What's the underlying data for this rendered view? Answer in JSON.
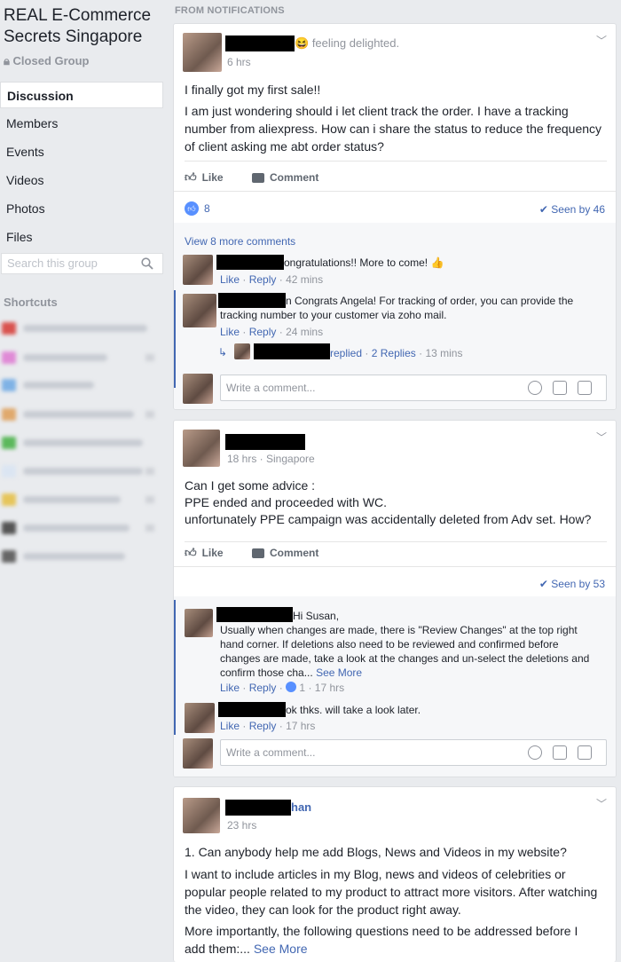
{
  "sidebar": {
    "group_name": "REAL E-Commerce Secrets Singapore",
    "privacy": "Closed Group",
    "nav": [
      "Discussion",
      "Members",
      "Events",
      "Videos",
      "Photos",
      "Files"
    ],
    "search_placeholder": "Search this group",
    "shortcuts_label": "Shortcuts"
  },
  "feed": {
    "section_label": "FROM NOTIFICATIONS",
    "like_label": "Like",
    "comment_label": "Comment",
    "write_comment_placeholder": "Write a comment...",
    "reply_label": "Reply",
    "see_more": "See More"
  },
  "post1": {
    "feeling": "feeling delighted.",
    "time": "6 hrs",
    "line1": "I finally got my first sale!!",
    "line2": "I am just wondering should i let client track the order. I have a tracking number from aliexpress. How can i share the status to reduce the frequency of client asking me abt order status?",
    "reactions": "8",
    "seen": "Seen by 46",
    "view_more": "View 8 more comments",
    "c1_text": "ongratulations!! More to come!",
    "c1_time": "42 mins",
    "c2_text": "n Congrats Angela! For tracking of order, you can provide the tracking number to your customer via zoho mail.",
    "c2_time": "24 mins",
    "reply_text": "replied",
    "reply_count": "2 Replies",
    "reply_time": "13 mins"
  },
  "post2": {
    "time": "18 hrs · Singapore",
    "line1": "Can I get some advice :",
    "line2": "PPE ended and proceeded with WC.",
    "line3": "unfortunately PPE campaign was accidentally deleted from Adv set. How?",
    "seen": "Seen by 53",
    "c1_text": "Hi Susan,\nUsually when changes are made, there is \"Review Changes\" at the top right hand corner. If deletions also need to be reviewed and confirmed before changes are made, take a look at the changes and un-select the deletions and confirm those cha...",
    "c1_likes": "1",
    "c1_time": "17 hrs",
    "c2_text": "ok thks. will take a look later.",
    "c2_time": "17 hrs"
  },
  "post3": {
    "name_suffix": "han",
    "time": "23 hrs",
    "line1": "1. Can anybody help me add Blogs, News and Videos in my website?",
    "line2": "I want to include articles in my Blog, news and videos of celebrities or popular people related to my product to attract more visitors. After watching the video, they can look for the product right away.",
    "line3": "More importantly, the following questions need to be addressed before I add them:..."
  },
  "colors": {
    "accent": "#4267b2",
    "bg": "#e9ebee",
    "text": "#1d2129",
    "meta": "#90949c"
  }
}
